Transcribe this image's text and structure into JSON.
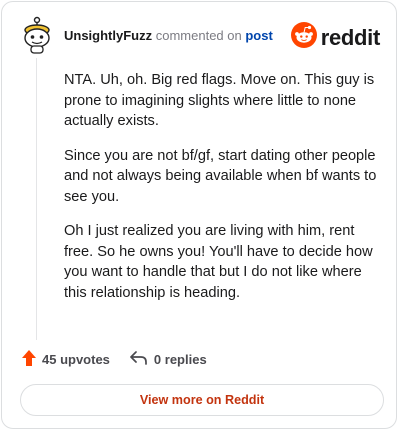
{
  "comment": {
    "username": "UnsightlyFuzz",
    "action_text": "commented on",
    "link_text": "post",
    "paragraphs": [
      "NTA. Uh, oh. Big red flags. Move on. This guy is prone to imagining slights where little to none actually exists.",
      "Since you are not bf/gf, start dating other people and not always being available when bf wants to see you.",
      "Oh I just realized you are living with him, rent free. So he owns you! You'll have to decide how you want to handle that but I do not like where this relationship is heading."
    ]
  },
  "brand": {
    "name": "reddit",
    "icon": "reddit-snoo-icon",
    "color": "#ff4500"
  },
  "stats": {
    "upvotes_label": "45 upvotes",
    "replies_label": "0 replies",
    "upvote_icon": "upvote-arrow-icon",
    "reply_icon": "reply-arrow-icon",
    "upvote_color": "#ff4500"
  },
  "footer": {
    "view_more_label": "View more on Reddit"
  }
}
